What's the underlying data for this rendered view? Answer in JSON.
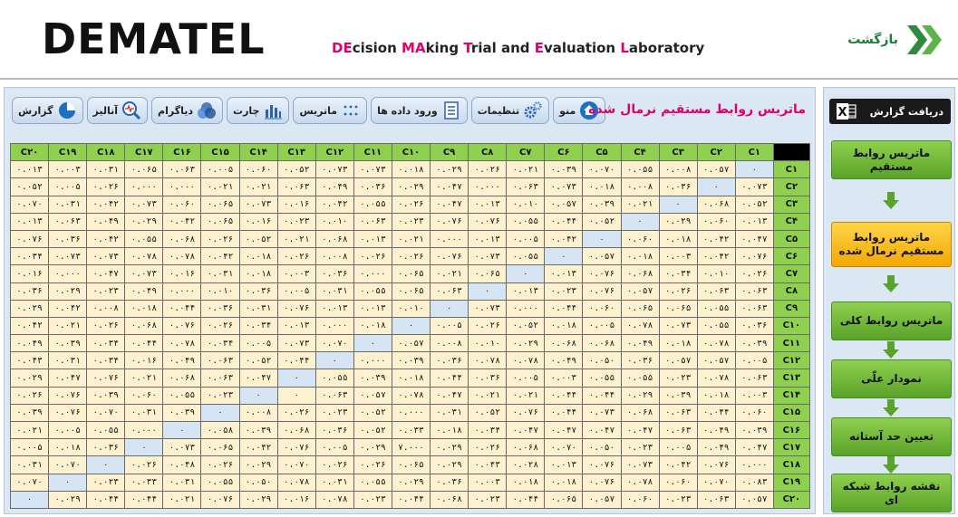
{
  "header": {
    "logo": "DEMATEL",
    "subtitle_parts": [
      {
        "t": "DE",
        "hl": true
      },
      {
        "t": "cision ",
        "hl": false
      },
      {
        "t": "MA",
        "hl": true
      },
      {
        "t": "king ",
        "hl": false
      },
      {
        "t": "T",
        "hl": true
      },
      {
        "t": "rial and ",
        "hl": false
      },
      {
        "t": "E",
        "hl": true
      },
      {
        "t": "valuation ",
        "hl": false
      },
      {
        "t": "L",
        "hl": true
      },
      {
        "t": "aboratory",
        "hl": false
      }
    ],
    "back_label": "بازگشت",
    "back_icon": "double-chevron-right-icon"
  },
  "toolbar": [
    {
      "name": "menu-button",
      "label": "منو",
      "icon": "home-icon"
    },
    {
      "name": "settings-button",
      "label": "تنظیمات",
      "icon": "gears-icon"
    },
    {
      "name": "data-entry-button",
      "label": "ورود داده ها",
      "icon": "form-icon"
    },
    {
      "name": "matrix-button",
      "label": "ماتریس",
      "icon": "dots-grid-icon"
    },
    {
      "name": "chart-button",
      "label": "چارت",
      "icon": "bar-chart-icon"
    },
    {
      "name": "diagram-button",
      "label": "دیاگرام",
      "icon": "venn-icon"
    },
    {
      "name": "analysis-button",
      "label": "آنالیز",
      "icon": "magnifier-pulse-icon"
    },
    {
      "name": "report-toolbar-button",
      "label": "گزارش",
      "icon": "pie-chart-icon"
    }
  ],
  "page_heading": "ماتریس روابط مستقیم نرمال شده",
  "matrix": {
    "columns": [
      "C1",
      "C2",
      "C3",
      "C4",
      "C5",
      "C6",
      "C7",
      "C8",
      "C9",
      "C10",
      "C11",
      "C12",
      "C13",
      "C14",
      "C15",
      "C16",
      "C17",
      "C18",
      "C19",
      "C20"
    ],
    "column_labels": [
      "C۱",
      "C۲",
      "C۳",
      "C۴",
      "C۵",
      "C۶",
      "C۷",
      "C۸",
      "C۹",
      "C۱۰",
      "C۱۱",
      "C۱۲",
      "C۱۳",
      "C۱۴",
      "C۱۵",
      "C۱۶",
      "C۱۷",
      "C۱۸",
      "C۱۹",
      "C۲۰"
    ],
    "row_labels": [
      "C۱",
      "C۲",
      "C۳",
      "C۴",
      "C۵",
      "C۶",
      "C۷",
      "C۸",
      "C۹",
      "C۱۰",
      "C۱۱",
      "C۱۲",
      "C۱۳",
      "C۱۴",
      "C۱۵",
      "C۱۶",
      "C۱۷",
      "C۱۸",
      "C۱۹",
      "C۲۰"
    ],
    "rows": [
      [
        "۰",
        "۰.۰۵۷",
        "۰.۰۰۸",
        "۰.۰۵۵",
        "۰.۰۷۰",
        "۰.۰۳۹",
        "۰.۰۲۱",
        "۰.۰۲۶",
        "۰.۰۲۹",
        "۰.۰۱۸",
        "۰.۰۷۳",
        "۰.۰۷۳",
        "۰.۰۵۲",
        "۰.۰۶۰",
        "۰.۰۰۵",
        "۰.۰۶۳",
        "۰.۰۶۵",
        "۰.۰۳۱",
        "۰.۰۰۳",
        "۰.۰۱۳"
      ],
      [
        "۰.۰۷۳",
        "۰",
        "۰.۰۳۶",
        "۰.۰۰۸",
        "۰.۰۱۸",
        "۰.۰۷۳",
        "۰.۰۶۳",
        "۰.۰۰۰",
        "۰.۰۴۷",
        "۰.۰۲۹",
        "۰.۰۳۶",
        "۰.۰۴۹",
        "۰.۰۶۳",
        "۰.۰۲۱",
        "۰.۰۲۱",
        "۰.۰۰۰",
        "۰.۰۰۰",
        "۰.۰۲۶",
        "۰.۰۰۵",
        "۰.۰۵۲"
      ],
      [
        "۰.۰۵۲",
        "۰.۰۶۸",
        "۰",
        "۰.۰۲۱",
        "۰.۰۳۹",
        "۰.۰۵۷",
        "۰.۰۱۰",
        "۰.۰۱۳",
        "۰.۰۴۷",
        "۰.۰۲۶",
        "۰.۰۵۵",
        "۰.۰۴۲",
        "۰.۰۱۶",
        "۰.۰۷۳",
        "۰.۰۶۵",
        "۰.۰۶۰",
        "۰.۰۷۳",
        "۰.۰۴۲",
        "۰.۰۳۱",
        "۰.۰۷۰"
      ],
      [
        "۰.۰۱۳",
        "۰.۰۶۰",
        "۰.۰۲۹",
        "۰",
        "۰.۰۵۲",
        "۰.۰۴۴",
        "۰.۰۵۵",
        "۰.۰۷۶",
        "۰.۰۷۶",
        "۰.۰۲۳",
        "۰.۰۶۳",
        "۰.۰۱۰",
        "۰.۰۲۳",
        "۰.۰۱۶",
        "۰.۰۶۵",
        "۰.۰۴۲",
        "۰.۰۲۹",
        "۰.۰۴۹",
        "۰.۰۶۳",
        "۰.۰۱۳"
      ],
      [
        "۰.۰۴۷",
        "۰.۰۴۲",
        "۰.۰۱۸",
        "۰.۰۶۰",
        "۰",
        "۰.۰۴۲",
        "۰.۰۰۵",
        "۰.۰۱۳",
        "۰.۰۰۰",
        "۰.۰۲۱",
        "۰.۰۱۳",
        "۰.۰۶۸",
        "۰.۰۲۱",
        "۰.۰۵۲",
        "۰.۰۲۶",
        "۰.۰۶۸",
        "۰.۰۵۵",
        "۰.۰۴۲",
        "۰.۰۳۶",
        "۰.۰۷۶"
      ],
      [
        "۰.۰۷۶",
        "۰.۰۴۲",
        "۰.۰۰۳",
        "۰.۰۱۸",
        "۰.۰۵۷",
        "۰",
        "۰.۰۵۵",
        "۰.۰۷۳",
        "۰.۰۷۶",
        "۰.۰۲۶",
        "۰.۰۲۶",
        "۰.۰۰۸",
        "۰.۰۲۶",
        "۰.۰۱۸",
        "۰.۰۴۲",
        "۰.۰۷۸",
        "۰.۰۷۸",
        "۰.۰۷۳",
        "۰.۰۷۳",
        "۰.۰۳۴"
      ],
      [
        "۰.۰۲۶",
        "۰.۰۱۰",
        "۰.۰۳۴",
        "۰.۰۶۸",
        "۰.۰۷۶",
        "۰.۰۱۳",
        "۰",
        "۰.۰۶۵",
        "۰.۰۲۱",
        "۰.۰۶۵",
        "۰.۰۰۰",
        "۰.۰۳۶",
        "۰.۰۰۳",
        "۰.۰۱۸",
        "۰.۰۳۱",
        "۰.۰۱۶",
        "۰.۰۷۳",
        "۰.۰۴۷",
        "۰.۰۰۰",
        "۰.۰۱۶"
      ],
      [
        "۰.۰۶۳",
        "۰.۰۶۳",
        "۰.۰۲۶",
        "۰.۰۵۷",
        "۰.۰۷۶",
        "۰.۰۲۳",
        "۰.۰۱۳",
        "۰",
        "۰.۰۶۳",
        "۰.۰۶۵",
        "۰.۰۵۵",
        "۰.۰۳۱",
        "۰.۰۰۵",
        "۰.۰۳۶",
        "۰.۰۱۰",
        "۰.۰۰۰",
        "۰.۰۴۹",
        "۰.۰۲۳",
        "۰.۰۲۹",
        "۰.۰۳۶"
      ],
      [
        "۰.۰۶۳",
        "۰.۰۵۵",
        "۰.۰۶۵",
        "۰.۰۶۵",
        "۰.۰۶۰",
        "۰.۰۴۴",
        "۰.۰۰۰",
        "۰.۰۷۳",
        "۰",
        "۰.۰۱۰",
        "۰.۰۱۳",
        "۰.۰۱۳",
        "۰.۰۷۶",
        "۰.۰۳۱",
        "۰.۰۳۶",
        "۰.۰۴۴",
        "۰.۰۱۸",
        "۰.۰۰۸",
        "۰.۰۴۲",
        "۰.۰۲۹"
      ],
      [
        "۰.۰۳۶",
        "۰.۰۵۵",
        "۰.۰۷۳",
        "۰.۰۷۸",
        "۰.۰۰۵",
        "۰.۰۱۸",
        "۰.۰۵۲",
        "۰.۰۲۶",
        "۰.۰۰۵",
        "۰",
        "۰.۰۱۸",
        "۰.۰۰۰",
        "۰.۰۱۳",
        "۰.۰۳۴",
        "۰.۰۲۶",
        "۰.۰۷۶",
        "۰.۰۶۸",
        "۰.۰۲۶",
        "۰.۰۲۱",
        "۰.۰۴۲"
      ],
      [
        "۰.۰۳۹",
        "۰.۰۷۸",
        "۰.۰۱۸",
        "۰.۰۴۹",
        "۰.۰۶۸",
        "۰.۰۶۸",
        "۰.۰۲۹",
        "۰.۰۱۰",
        "۰.۰۰۸",
        "۰.۰۵۷",
        "۰",
        "۰.۰۷۰",
        "۰.۰۷۳",
        "۰.۰۰۵",
        "۰.۰۳۴",
        "۰.۰۷۸",
        "۰.۰۴۴",
        "۰.۰۳۴",
        "۰.۰۳۹",
        "۰.۰۴۹"
      ],
      [
        "۰.۰۰۵",
        "۰.۰۵۷",
        "۰.۰۵۷",
        "۰.۰۳۶",
        "۰.۰۵۰",
        "۰.۰۴۹",
        "۰.۰۷۸",
        "۰.۰۷۸",
        "۰.۰۳۶",
        "۰.۰۳۹",
        "۰.۰۰۰",
        "۰",
        "۰.۰۴۴",
        "۰.۰۵۲",
        "۰.۰۶۳",
        "۰.۰۴۹",
        "۰.۰۱۶",
        "۰.۰۳۴",
        "۰.۰۳۱",
        "۰.۰۴۳"
      ],
      [
        "۰.۰۶۳",
        "۰.۰۷۸",
        "۰.۰۲۳",
        "۰.۰۵۵",
        "۰.۰۵۵",
        "۰.۰۰۳",
        "۰.۰۰۵",
        "۰.۰۳۶",
        "۰.۰۴۴",
        "۰.۰۱۸",
        "۰.۰۳۹",
        "۰.۰۵۵",
        "۰",
        "۰.۰۴۷",
        "۰.۰۶۳",
        "۰.۰۶۸",
        "۰.۰۲۱",
        "۰.۰۷۶",
        "۰.۰۴۷",
        "۰.۰۲۹"
      ],
      [
        "۰.۰۰۳",
        "۰.۰۱۸",
        "۰.۰۳۹",
        "۰.۰۲۹",
        "۰.۰۴۴",
        "۰.۰۴۴",
        "۰.۰۲۱",
        "۰.۰۲۱",
        "۰.۰۴۷",
        "۰.۰۷۸",
        "۰.۰۵۷",
        "۰.۰۶۳",
        "۰",
        "۰",
        "۰.۰۲۳",
        "۰.۰۵۵",
        "۰.۰۶۰",
        "۰.۰۳۹",
        "۰.۰۷۶",
        "۰.۰۲۶"
      ],
      [
        "۰.۰۶۰",
        "۰.۰۴۴",
        "۰.۰۶۳",
        "۰.۰۶۸",
        "۰.۰۷۳",
        "۰.۰۴۴",
        "۰.۰۷۶",
        "۰.۰۵۲",
        "۰.۰۳۱",
        "۰.۰۰۰",
        "۰.۰۵۲",
        "۰.۰۲۳",
        "۰.۰۲۶",
        "۰.۰۰۸",
        "۰",
        "۰.۰۳۹",
        "۰.۰۳۱",
        "۰.۰۷۰",
        "۰.۰۷۶",
        "۰.۰۳۹"
      ],
      [
        "۰.۰۳۹",
        "۰.۰۴۹",
        "۰.۰۶۳",
        "۰.۰۴۷",
        "۰.۰۴۷",
        "۰.۰۴۷",
        "۰.۰۴۷",
        "۰.۰۳۴",
        "۰.۰۱۸",
        "۰.۰۳۳",
        "۰.۰۵۲",
        "۰.۰۳۶",
        "۰.۰۶۸",
        "۰.۰۳۹",
        "۰.۰۵۸",
        "۰",
        "۰.۰۰۰",
        "۰.۰۵۵",
        "۰.۰۰۵",
        "۰.۰۲۱"
      ],
      [
        "۰.۰۴۷",
        "۰.۰۴۹",
        "۰.۰۰۵",
        "۰.۰۲۳",
        "۰.۰۵۰",
        "۰.۰۷۰",
        "۰.۰۶۸",
        "۰.۰۲۶",
        "۰.۰۲۹",
        "۷.۰۰۰",
        "۰.۰۲۹",
        "۰.۰۰۵",
        "۰.۰۷۶",
        "۰.۰۴۲",
        "۰.۰۶۵",
        "۰.۰۷۳",
        "۰",
        "۰.۰۳۶",
        "۰.۰۱۸",
        "۰.۰۰۵"
      ],
      [
        "۰.۰۰۰",
        "۰.۰۷۶",
        "۰.۰۴۲",
        "۰.۰۷۳",
        "۰.۰۷۶",
        "۰.۰۱۳",
        "۰.۰۲۸",
        "۰.۰۴۳",
        "۰.۰۲۹",
        "۰.۰۶۵",
        "۰.۰۲۶",
        "۰.۰۲۶",
        "۰.۰۷۰",
        "۰.۰۲۹",
        "۰.۰۲۶",
        "۰.۰۴۸",
        "۰.۰۲۶",
        "۰",
        "۰.۰۷۰",
        "۰.۰۳۱"
      ],
      [
        "۰.۰۸۳",
        "۰.۰۷۰",
        "۰.۰۶۰",
        "۰.۰۷۸",
        "۰.۰۷۶",
        "۰.۰۱۸",
        "۰.۰۱۸",
        "۰.۰۰۳",
        "۰.۰۳۶",
        "۰.۰۲۹",
        "۰.۰۵۵",
        "۰.۰۳۱",
        "۰.۰۷۸",
        "۰.۰۵۰",
        "۰.۰۵۵",
        "۰.۰۳۱",
        "۰.۰۳۳",
        "۰.۰۲۳",
        "۰",
        "۰.۰۷۰"
      ],
      [
        "۰.۰۵۷",
        "۰.۰۶۳",
        "۰.۰۲۳",
        "۰.۰۶۰",
        "۰.۰۵۷",
        "۰.۰۶۵",
        "۰.۰۴۴",
        "۰.۰۲۳",
        "۰.۰۶۸",
        "۰.۰۴۴",
        "۰.۰۲۳",
        "۰.۰۷۸",
        "۰.۰۱۶",
        "۰.۰۲۹",
        "۰.۰۷۶",
        "۰.۰۲۱",
        "۰.۰۴۴",
        "۰.۰۴۴",
        "۰.۰۲۹",
        "۰"
      ]
    ]
  },
  "side": {
    "report_label": "دریافت گزارش",
    "report_icon": "excel-icon",
    "flow": [
      {
        "name": "flow-direct-matrix",
        "label": "ماتریس روابط مستقیم",
        "style": "green"
      },
      {
        "name": "flow-normalized-matrix",
        "label": "ماتریس روابط مستقیم نرمال شده",
        "style": "gold"
      },
      {
        "name": "flow-total-matrix",
        "label": "ماتریس روابط کلی",
        "style": "green"
      },
      {
        "name": "flow-causal-diagram",
        "label": "نمودار علّی",
        "style": "green"
      },
      {
        "name": "flow-threshold",
        "label": "تعیین حد آستانه",
        "style": "green"
      },
      {
        "name": "flow-network-map",
        "label": "نقشه روابط شبکه ای",
        "style": "green"
      }
    ]
  },
  "colors": {
    "accent_pink": "#e1006e",
    "header_green": "#8fd04e",
    "cell_cream": "#fdf1cf",
    "diag_blue": "#d6e5f4",
    "panel_bg": "#dbe7f3"
  }
}
